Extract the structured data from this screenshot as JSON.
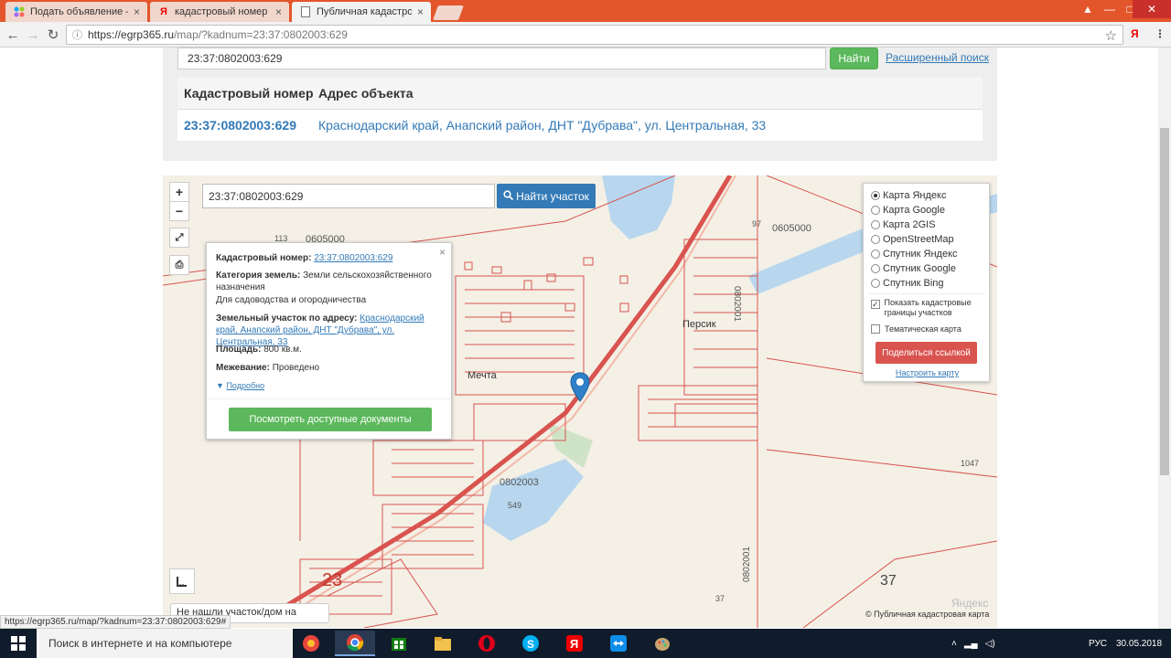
{
  "browser": {
    "tabs": [
      {
        "title": "Подать объявление — С",
        "icon": "avito-icon"
      },
      {
        "title": "кадастровый номер — Я",
        "icon": "yandex-icon"
      },
      {
        "title": "Публичная кадастрова",
        "icon": "page-icon"
      }
    ],
    "url_domain": "https://egrp365.ru",
    "url_path": "/map/?kadnum=23:37:0802003:629"
  },
  "search": {
    "value": "23:37:0802003:629",
    "find_label": "Найти",
    "advanced_label": "Расширенный поиск"
  },
  "results": {
    "headers": [
      "Кадастровый номер",
      "Адрес объекта"
    ],
    "row": {
      "kadnum": "23:37:0802003:629",
      "address": "Краснодарский край, Анапский район, ДНТ \"Дубрава\", ул. Центральная, 33"
    }
  },
  "map": {
    "search_value": "23:37:0802003:629",
    "find_parcel_label": "Найти участок",
    "zoom_in": "+",
    "zoom_out": "−",
    "labels": [
      "113",
      "0605000",
      "97",
      "0605000",
      "Персик",
      "Мечта",
      "0802003",
      "549",
      "1047",
      "23",
      "37",
      "37",
      "0802001",
      "0802001"
    ],
    "not_found": "Не нашли участок/дом на карте?",
    "copyright": "© Публичная кадастровая карта",
    "yandex": "Яндекс",
    "pin_color": "#2f80c8"
  },
  "popup": {
    "kadnum_label": "Кадастровый номер:",
    "kadnum_value": "23:37:0802003:629",
    "category_label": "Категория земель:",
    "category_value": "Земли сельскохозяйственного назначения",
    "purpose": "Для садоводства и огородничества",
    "address_label": "Земельный участок по адресу:",
    "address_value": "Краснодарский край, Анапский район, ДНТ \"Дубрава\", ул. Центральная, 33",
    "area_label": "Площадь:",
    "area_value": "800 кв.м.",
    "survey_label": "Межевание:",
    "survey_value": "Проведено",
    "more_label": "Подробно",
    "docs_button": "Посмотреть доступные документы"
  },
  "layers": {
    "options": [
      "Карта Яндекс",
      "Карта Google",
      "Карта 2GIS",
      "OpenStreetMap",
      "Спутник Яндекс",
      "Спутник Google",
      "Спутник Bing"
    ],
    "selected": "Карта Яндекс",
    "show_borders": "Показать кадастровые границы участков",
    "show_borders_checked": true,
    "thematic": "Тематическая карта",
    "thematic_checked": false,
    "share_label": "Поделиться ссылкой",
    "setup_label": "Настроить карту"
  },
  "statusbar": "https://egrp365.ru/map/?kadnum=23:37:0802003:629#",
  "taskbar": {
    "search_placeholder": "Поиск в интернете и на компьютере",
    "lang": "РУС",
    "date": "30.05.2018"
  },
  "colors": {
    "tabbar": "#e3562b",
    "parcel_line": "#d9534f",
    "water": "#b8d7ee",
    "green": "#5cb85c",
    "blue": "#337ab7"
  }
}
